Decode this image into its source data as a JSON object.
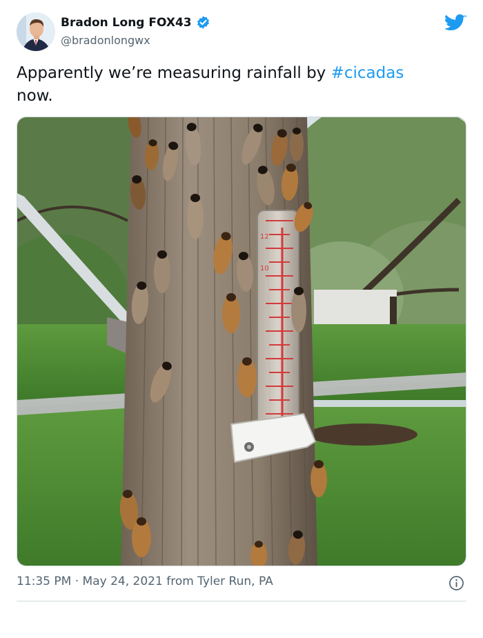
{
  "author": {
    "display_name": "Bradon Long FOX43",
    "handle": "@bradonlongwx",
    "verified_icon": "verified-badge-icon",
    "avatar_icon": "profile-avatar"
  },
  "brand": {
    "logo_icon": "twitter-bird-icon",
    "accent_color": "#1d9bf0"
  },
  "tweet": {
    "text_before": "Apparently we’re measuring rainfall by ",
    "hashtag": "#cicadas",
    "text_after": " now."
  },
  "photo": {
    "subject": "tree-with-cicadas-and-rain-gauge",
    "gauge_marks": [
      "12",
      "10"
    ]
  },
  "meta": {
    "time": "11:35 PM",
    "separator": " · ",
    "date": "May 24, 2021",
    "source": " from Tyler Run, PA",
    "info_icon": "info-icon"
  }
}
